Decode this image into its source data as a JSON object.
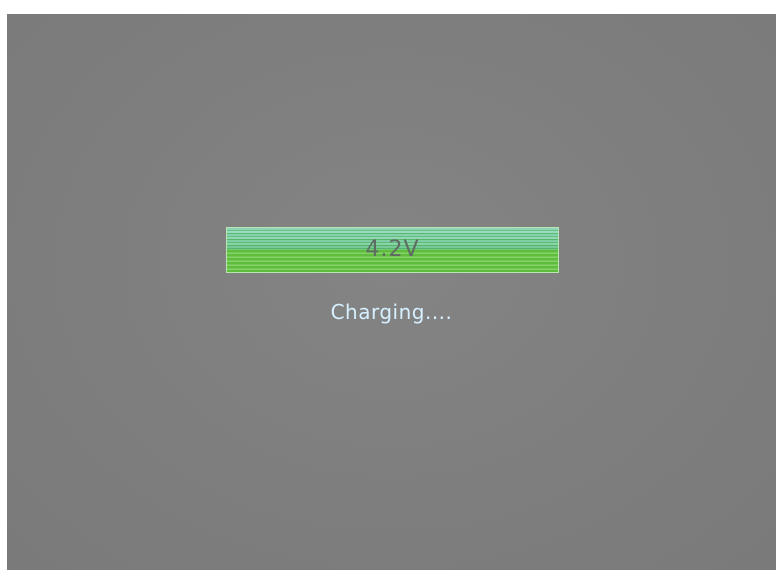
{
  "battery": {
    "voltage_label": "4.2V",
    "charge_fraction": 1.0,
    "fill_color": "#6fc44f",
    "highlight_color": "#bfe9d9"
  },
  "status": {
    "text": "Charging...."
  },
  "colors": {
    "screen_background": "#7f7f7f",
    "status_text": "#d6f0ff",
    "voltage_text": "#5e6b63"
  }
}
